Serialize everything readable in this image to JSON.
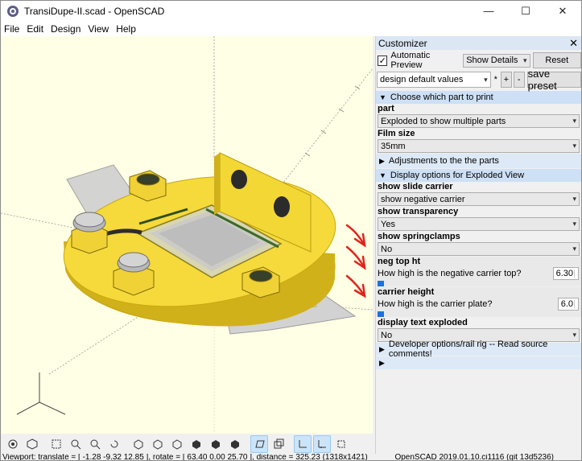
{
  "window": {
    "title": "TransiDupe-II.scad - OpenSCAD",
    "minimize": "—",
    "maximize": "☐",
    "close": "✕"
  },
  "menu": [
    "File",
    "Edit",
    "Design",
    "View",
    "Help"
  ],
  "customizer": {
    "title": "Customizer",
    "close": "✕",
    "auto_preview_label": "Automatic Preview",
    "auto_preview_checked": true,
    "show_details": "Show Details",
    "reset_label": "Reset",
    "preset_value": "design default values",
    "preset_star": "*",
    "add_label": "+",
    "remove_label": "-",
    "save_preset_label": "save preset",
    "groups": {
      "choose_part": "Choose which part to print",
      "adjustments": "Adjustments to the the parts",
      "display_options": "Display options for Exploded View",
      "developer": "Developer options/rail rig -- Read source comments!"
    },
    "params": {
      "part_label": "part",
      "part_value": "Exploded to show multiple parts",
      "film_label": "Film size",
      "film_value": "35mm",
      "slide_carrier_label": "show slide carrier",
      "slide_carrier_value": "show negative carrier",
      "transparency_label": "show transparency",
      "transparency_value": "Yes",
      "springclamps_label": "show springclamps",
      "springclamps_value": "No",
      "neg_top_label": "neg top ht",
      "neg_top_desc": "How high is the negative carrier top?",
      "neg_top_value": "6.30",
      "carrier_height_label": "carrier height",
      "carrier_height_desc": "How high is the carrier plate?",
      "carrier_height_value": "6.0",
      "display_text_label": "display text exploded",
      "display_text_value": "No"
    }
  },
  "status": {
    "viewport": "Viewport: translate = [ -1.28 -9.32 12.85 ], rotate = [ 63.40 0.00 25.70 ], distance = 325.23 (1318x1421)",
    "version": "OpenSCAD 2019.01.10.ci1116 (git 13d5236)"
  },
  "colors": {
    "viewport_bg": "#ffffe5",
    "model_yellow": "#f5d83a",
    "header_blue": "#cde0f5",
    "annotation_red": "#e0231b"
  }
}
